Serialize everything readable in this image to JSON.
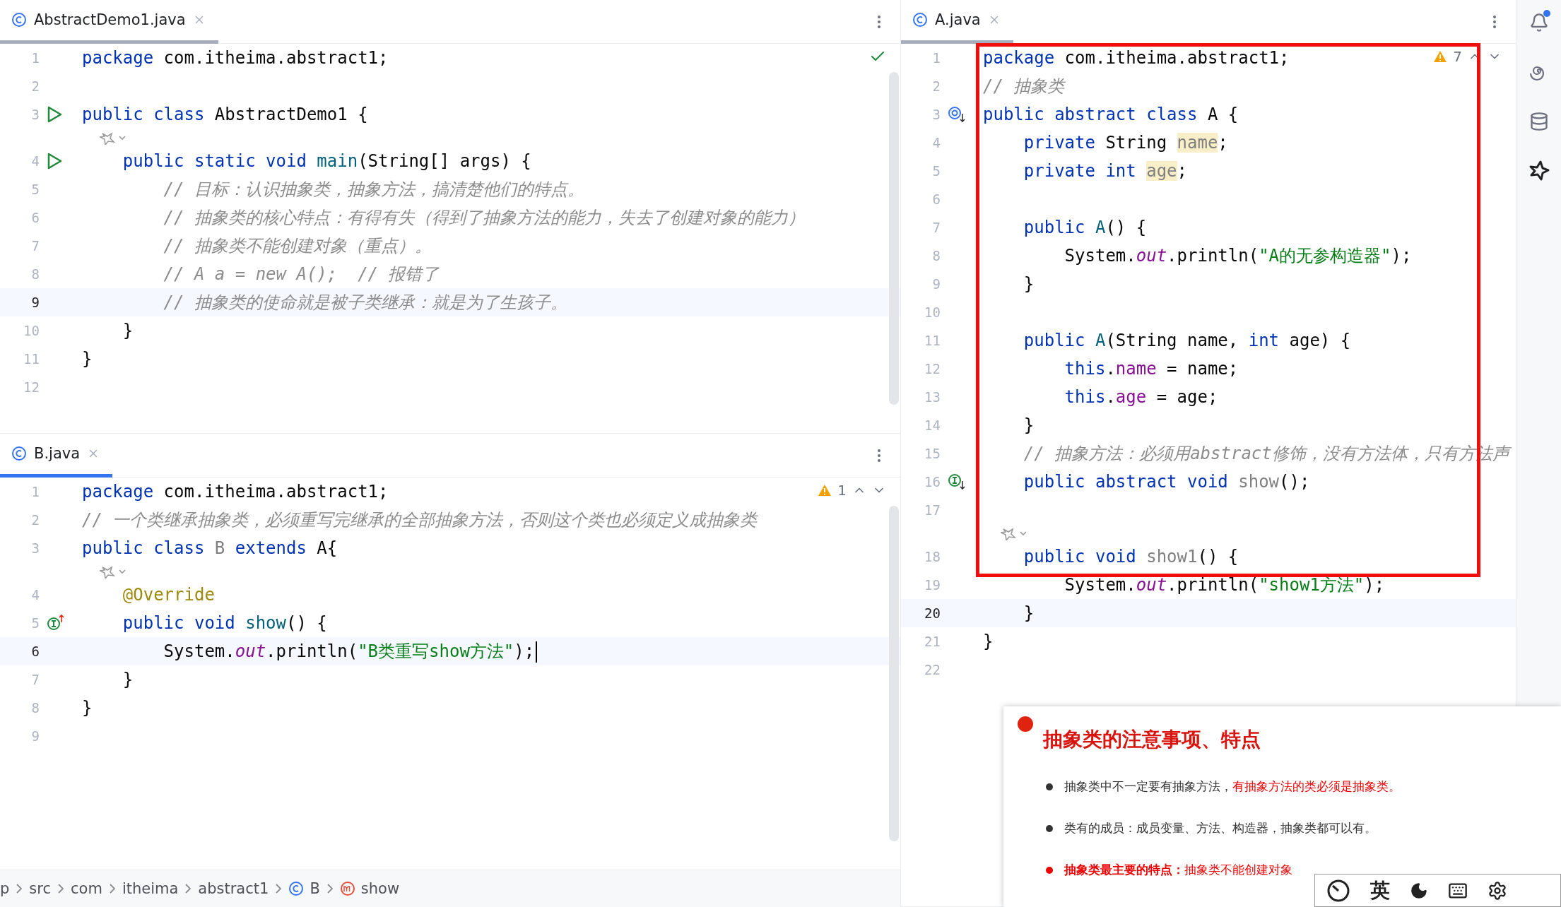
{
  "editors": [
    {
      "tab": {
        "label": "AbstractDemo1.java",
        "selected": true
      },
      "focused": false,
      "inspection": {
        "kind": "ok"
      },
      "lines": [
        {
          "kind": "code",
          "num": "1",
          "current": false,
          "tokens": [
            {
              "kind": "kw",
              "text": "package"
            },
            {
              "kind": "plain",
              "text": " com.itheima.abstract1;"
            }
          ]
        },
        {
          "kind": "code",
          "num": "2",
          "current": false
        },
        {
          "kind": "code",
          "num": "3",
          "current": false,
          "gutter_icon": {
            "kind": "run"
          },
          "tokens": [
            {
              "kind": "kw",
              "text": "public class"
            },
            {
              "kind": "plain",
              "text": " AbstractDemo1 {"
            }
          ]
        },
        {
          "kind": "hint"
        },
        {
          "kind": "code",
          "num": "4",
          "current": false,
          "gutter_icon": {
            "kind": "run"
          },
          "tokens": [
            {
              "kind": "kw",
              "text": "    public static void"
            },
            {
              "kind": "decl",
              "text": " main"
            },
            {
              "kind": "plain",
              "text": "(String[] args) {"
            }
          ]
        },
        {
          "kind": "code",
          "num": "5",
          "current": false,
          "tokens": [
            {
              "kind": "comment",
              "text": "        // 目标：认识抽象类，抽象方法，搞清楚他们的特点。"
            }
          ]
        },
        {
          "kind": "code",
          "num": "6",
          "current": false,
          "tokens": [
            {
              "kind": "comment",
              "text": "        // 抽象类的核心特点：有得有失（得到了抽象方法的能力，失去了创建对象的能力）"
            }
          ]
        },
        {
          "kind": "code",
          "num": "7",
          "current": false,
          "tokens": [
            {
              "kind": "comment",
              "text": "        // 抽象类不能创建对象（重点）。"
            }
          ]
        },
        {
          "kind": "code",
          "num": "8",
          "current": false,
          "tokens": [
            {
              "kind": "comment",
              "text": "        // A a = new A();  // 报错了"
            }
          ]
        },
        {
          "kind": "code",
          "num": "9",
          "current": true,
          "tokens": [
            {
              "kind": "comment",
              "text": "        // 抽象类的使命就是被子类继承：就是为了生孩子。"
            }
          ]
        },
        {
          "kind": "code",
          "num": "10",
          "current": false,
          "tokens": [
            {
              "kind": "plain",
              "text": "    }"
            }
          ]
        },
        {
          "kind": "code",
          "num": "11",
          "current": false,
          "tokens": [
            {
              "kind": "plain",
              "text": "}"
            }
          ]
        },
        {
          "kind": "code",
          "num": "12",
          "current": false
        }
      ]
    },
    {
      "tab": {
        "label": "B.java",
        "selected": true
      },
      "focused": true,
      "inspection": {
        "kind": "warning",
        "count": "1"
      },
      "lines": [
        {
          "kind": "code",
          "num": "1",
          "current": false,
          "tokens": [
            {
              "kind": "kw",
              "text": "package"
            },
            {
              "kind": "plain",
              "text": " com.itheima.abstract1;"
            }
          ]
        },
        {
          "kind": "code",
          "num": "2",
          "current": false,
          "tokens": [
            {
              "kind": "comment",
              "text": "// 一个类继承抽象类，必须重写完继承的全部抽象方法，否则这个类也必须定义成抽象类"
            }
          ]
        },
        {
          "kind": "code",
          "num": "3",
          "current": false,
          "tokens": [
            {
              "kind": "kw",
              "text": "public class"
            },
            {
              "kind": "unused",
              "text": " B"
            },
            {
              "kind": "kw",
              "text": " extends"
            },
            {
              "kind": "plain",
              "text": " A{"
            }
          ]
        },
        {
          "kind": "hint"
        },
        {
          "kind": "code",
          "num": "4",
          "current": false,
          "tokens": [
            {
              "kind": "ann",
              "text": "    @Override"
            }
          ]
        },
        {
          "kind": "code",
          "num": "5",
          "current": false,
          "gutter_icon": {
            "kind": "implements"
          },
          "tokens": [
            {
              "kind": "kw",
              "text": "    public void"
            },
            {
              "kind": "decl",
              "text": " show"
            },
            {
              "kind": "plain",
              "text": "() {"
            }
          ]
        },
        {
          "kind": "code",
          "num": "6",
          "current": true,
          "tokens": [
            {
              "kind": "plain",
              "text": "        System."
            },
            {
              "kind": "static",
              "text": "out"
            },
            {
              "kind": "plain",
              "text": ".println("
            },
            {
              "kind": "str",
              "text": "\"B类重写show方法\""
            },
            {
              "kind": "plain",
              "text": ");"
            }
          ]
        },
        {
          "kind": "code",
          "num": "7",
          "current": false,
          "tokens": [
            {
              "kind": "plain",
              "text": "    }"
            }
          ]
        },
        {
          "kind": "code",
          "num": "8",
          "current": false,
          "tokens": [
            {
              "kind": "plain",
              "text": "}"
            }
          ]
        },
        {
          "kind": "code",
          "num": "9",
          "current": false
        }
      ]
    },
    {
      "tab": {
        "label": "A.java",
        "selected": true
      },
      "focused": false,
      "inspection": {
        "kind": "warning",
        "count": "7"
      },
      "lines": [
        {
          "kind": "code",
          "num": "1",
          "current": false,
          "tokens": [
            {
              "kind": "kw",
              "text": "package"
            },
            {
              "kind": "plain",
              "text": " com.itheima.abstract1;"
            }
          ]
        },
        {
          "kind": "code",
          "num": "2",
          "current": false,
          "tokens": [
            {
              "kind": "comment",
              "text": "// 抽象类"
            }
          ]
        },
        {
          "kind": "code",
          "num": "3",
          "current": false,
          "gutter_icon": {
            "kind": "implemented"
          },
          "tokens": [
            {
              "kind": "kw",
              "text": "public abstract class"
            },
            {
              "kind": "plain",
              "text": " A {"
            }
          ]
        },
        {
          "kind": "code",
          "num": "4",
          "current": false,
          "tokens": [
            {
              "kind": "kw",
              "text": "    private"
            },
            {
              "kind": "plain",
              "text": " String "
            },
            {
              "kind": "unusedfield",
              "text": "name"
            },
            {
              "kind": "plain",
              "text": ";"
            }
          ]
        },
        {
          "kind": "code",
          "num": "5",
          "current": false,
          "tokens": [
            {
              "kind": "kw",
              "text": "    private int "
            },
            {
              "kind": "unusedfield",
              "text": "age"
            },
            {
              "kind": "plain",
              "text": ";"
            }
          ]
        },
        {
          "kind": "code",
          "num": "6",
          "current": false
        },
        {
          "kind": "code",
          "num": "7",
          "current": false,
          "tokens": [
            {
              "kind": "kw",
              "text": "    public"
            },
            {
              "kind": "decl",
              "text": " A"
            },
            {
              "kind": "plain",
              "text": "() {"
            }
          ]
        },
        {
          "kind": "code",
          "num": "8",
          "current": false,
          "tokens": [
            {
              "kind": "plain",
              "text": "        System."
            },
            {
              "kind": "static",
              "text": "out"
            },
            {
              "kind": "plain",
              "text": ".println("
            },
            {
              "kind": "str",
              "text": "\"A的无参构造器\""
            },
            {
              "kind": "plain",
              "text": ");"
            }
          ]
        },
        {
          "kind": "code",
          "num": "9",
          "current": false,
          "tokens": [
            {
              "kind": "plain",
              "text": "    }"
            }
          ]
        },
        {
          "kind": "code",
          "num": "10",
          "current": false
        },
        {
          "kind": "code",
          "num": "11",
          "current": false,
          "tokens": [
            {
              "kind": "kw",
              "text": "    public"
            },
            {
              "kind": "decl",
              "text": " A"
            },
            {
              "kind": "plain",
              "text": "(String name, "
            },
            {
              "kind": "kw",
              "text": "int"
            },
            {
              "kind": "plain",
              "text": " age) {"
            }
          ]
        },
        {
          "kind": "code",
          "num": "12",
          "current": false,
          "tokens": [
            {
              "kind": "kw",
              "text": "        this"
            },
            {
              "kind": "plain",
              "text": "."
            },
            {
              "kind": "field",
              "text": "name"
            },
            {
              "kind": "plain",
              "text": " = name;"
            }
          ]
        },
        {
          "kind": "code",
          "num": "13",
          "current": false,
          "tokens": [
            {
              "kind": "kw",
              "text": "        this"
            },
            {
              "kind": "plain",
              "text": "."
            },
            {
              "kind": "field",
              "text": "age"
            },
            {
              "kind": "plain",
              "text": " = age;"
            }
          ]
        },
        {
          "kind": "code",
          "num": "14",
          "current": false,
          "tokens": [
            {
              "kind": "plain",
              "text": "    }"
            }
          ]
        },
        {
          "kind": "code",
          "num": "15",
          "current": false,
          "tokens": [
            {
              "kind": "comment",
              "text": "    // 抽象方法：必须用abstract修饰，没有方法体，只有方法声"
            }
          ]
        },
        {
          "kind": "code",
          "num": "16",
          "current": false,
          "gutter_icon": {
            "kind": "abstract"
          },
          "tokens": [
            {
              "kind": "kw",
              "text": "    public abstract void"
            },
            {
              "kind": "unused",
              "text": " show"
            },
            {
              "kind": "plain",
              "text": "();"
            }
          ]
        },
        {
          "kind": "code",
          "num": "17",
          "current": false
        },
        {
          "kind": "hint"
        },
        {
          "kind": "code",
          "num": "18",
          "current": false,
          "tokens": [
            {
              "kind": "kw",
              "text": "    public void"
            },
            {
              "kind": "unused",
              "text": " show1"
            },
            {
              "kind": "plain",
              "text": "() {"
            }
          ]
        },
        {
          "kind": "code",
          "num": "19",
          "current": false,
          "tokens": [
            {
              "kind": "plain",
              "text": "        System."
            },
            {
              "kind": "static",
              "text": "out"
            },
            {
              "kind": "plain",
              "text": ".println("
            },
            {
              "kind": "str",
              "text": "\"show1方法\""
            },
            {
              "kind": "plain",
              "text": ");"
            }
          ]
        },
        {
          "kind": "code",
          "num": "20",
          "current": true,
          "tokens": [
            {
              "kind": "plain",
              "text": "    }"
            }
          ]
        },
        {
          "kind": "code",
          "num": "21",
          "current": false,
          "tokens": [
            {
              "kind": "plain",
              "text": "}"
            }
          ]
        },
        {
          "kind": "code",
          "num": "22",
          "current": false
        }
      ]
    }
  ],
  "breadcrumb": [
    {
      "kind": "plain",
      "label": "p"
    },
    {
      "kind": "plain",
      "label": "src"
    },
    {
      "kind": "plain",
      "label": "com"
    },
    {
      "kind": "plain",
      "label": "itheima"
    },
    {
      "kind": "plain",
      "label": "abstract1"
    },
    {
      "kind": "class",
      "label": "B"
    },
    {
      "kind": "method",
      "label": "show"
    }
  ],
  "slide": {
    "title": "抽象类的注意事项、特点",
    "bullets": [
      {
        "key": false,
        "segments": [
          {
            "kind": "plain",
            "text": "抽象类中不一定要有抽象方法，"
          },
          {
            "kind": "highlight",
            "text": "有抽象方法的类必须是抽象类。"
          }
        ]
      },
      {
        "key": false,
        "segments": [
          {
            "kind": "plain",
            "text": "类有的成员：成员变量、方法、构造器，抽象类都可以有。"
          }
        ]
      },
      {
        "key": true,
        "segments": [
          {
            "kind": "label",
            "text": "抽象类最主要的特点："
          },
          {
            "kind": "highlight",
            "text": "抽象类不能创建对象"
          }
        ]
      }
    ]
  },
  "ime": {
    "language": "英"
  }
}
